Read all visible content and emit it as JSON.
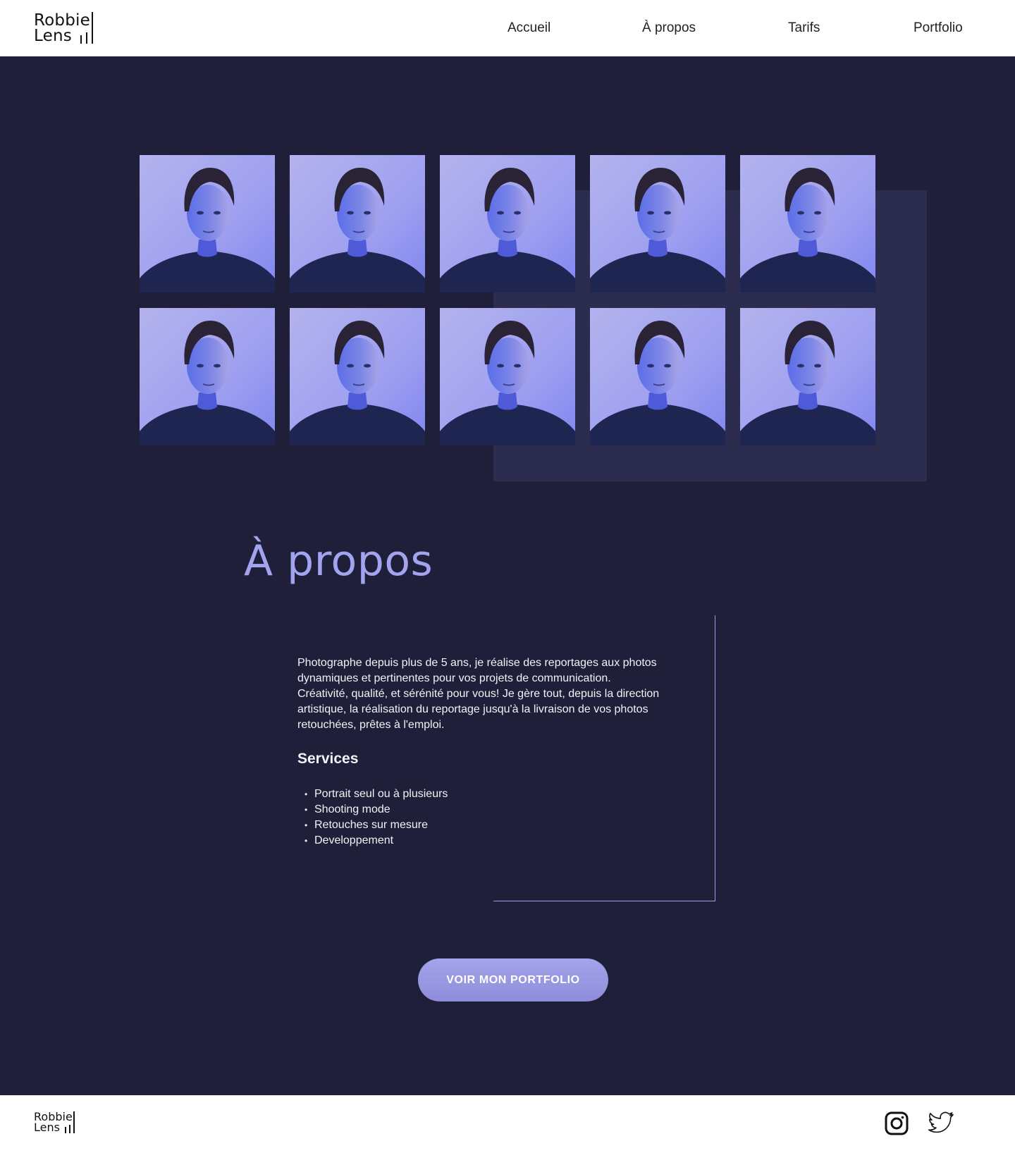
{
  "brand": {
    "line1": "Robbie",
    "line2": "Lens"
  },
  "nav": {
    "items": [
      {
        "label": "Accueil"
      },
      {
        "label": "À propos"
      },
      {
        "label": "Tarifs"
      },
      {
        "label": "Portfolio"
      }
    ]
  },
  "gallery": {
    "photo_count": 10,
    "colors": {
      "background": "#9e9ff0",
      "shirt": "#1e2550",
      "hair": "#2a2235",
      "skin": "#7d86e6"
    }
  },
  "about": {
    "title": "À propos",
    "text": "Photographe depuis plus de 5 ans, je réalise des reportages aux photos dynamiques et pertinentes pour vos projets de communication. Créativité, qualité, et sérénité pour vous! Je gère tout, depuis la direction artistique, la réalisation du reportage jusqu'à la livraison de vos photos retouchées, prêtes à l'emploi.",
    "services_title": "Services",
    "services": [
      "Portrait seul ou à plusieurs",
      "Shooting mode",
      "Retouches sur mesure",
      "Developpement"
    ]
  },
  "cta": {
    "label": "VOIR MON PORTFOLIO"
  },
  "footer": {
    "social": [
      {
        "icon": "instagram-icon"
      },
      {
        "icon": "twitter-icon"
      }
    ]
  },
  "colors": {
    "page_bg": "#1f1f3a",
    "panel": "#2c2c4e",
    "accent": "#a2a4f0",
    "header_bg": "#ffffff"
  }
}
